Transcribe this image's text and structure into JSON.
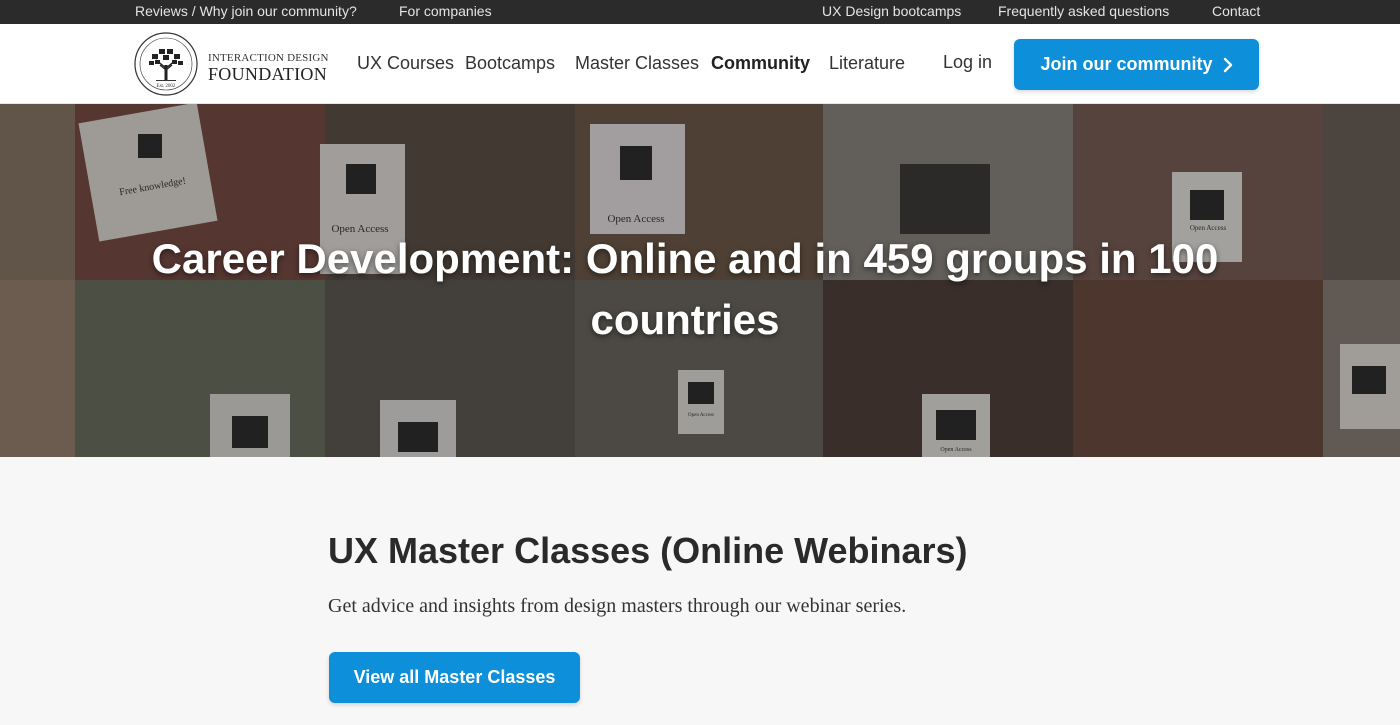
{
  "topbar": {
    "left_links": [
      "Reviews / Why join our community?",
      "For companies"
    ],
    "right_links": [
      "UX Design bootcamps",
      "Frequently asked questions",
      "Contact"
    ]
  },
  "logo": {
    "line1": "INTERACTION DESIGN",
    "line2": "FOUNDATION",
    "seal_text": "Est. 2002"
  },
  "nav": {
    "items": [
      "UX Courses",
      "Bootcamps",
      "Master Classes",
      "Community",
      "Literature"
    ],
    "active": "Community",
    "login": "Log in",
    "join": "Join our community",
    "join_icon": "chevron-right-icon"
  },
  "hero": {
    "title": "Career Development: Online and in 459 groups in 100 countries",
    "sign_labels": [
      "Free knowledge!",
      "Open Access",
      "Open Access",
      "Open Access",
      "Open Access",
      "Open Access"
    ]
  },
  "main": {
    "title": "UX Master Classes (Online Webinars)",
    "subtitle": "Get advice and insights from design masters through our webinar series.",
    "button": "View all Master Classes"
  },
  "colors": {
    "accent": "#0d8fd9",
    "topbar_bg": "#2b2b2b",
    "page_bg": "#f7f7f7"
  }
}
